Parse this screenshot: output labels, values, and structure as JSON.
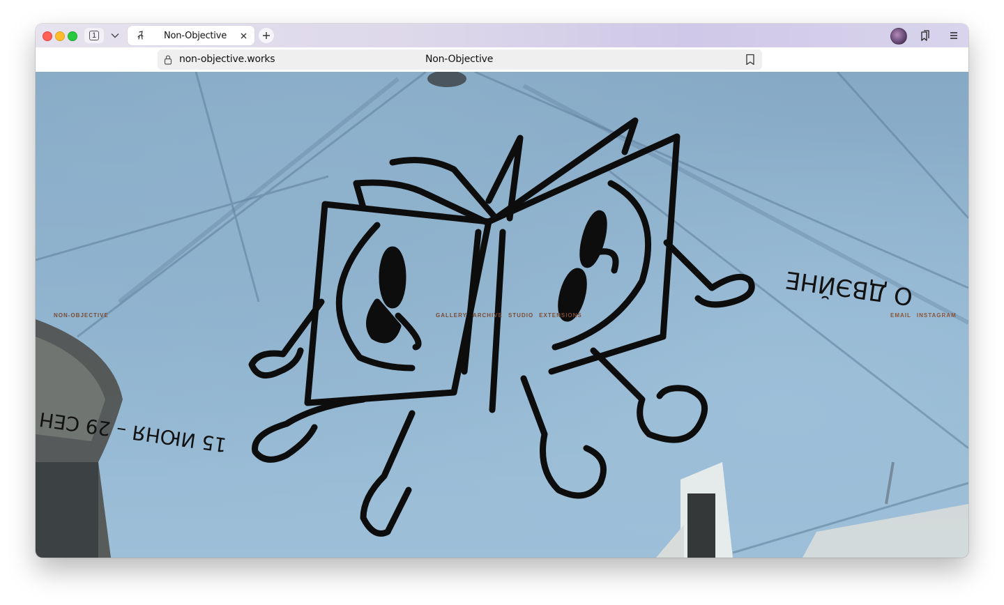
{
  "browser": {
    "tab_count": "1",
    "active_tab": {
      "title": "Non-Objective"
    },
    "address_bar": {
      "url": "non-objective.works",
      "page_title": "Non-Objective"
    }
  },
  "site": {
    "logo": "NON-OBJECTIVE",
    "nav": [
      "GALLERY",
      "ARCHIVE",
      "STUDIO",
      "EXTENSIONS"
    ],
    "links": [
      "EMAIL",
      "INSTAGRAM"
    ],
    "photo_text_right": "О ДВЭЙНЕ",
    "photo_text_left": "15 ИЮНЯ – 29 СЕН"
  },
  "colors": {
    "sky": "#92b5d1",
    "nav_text": "#7a4b33",
    "tabbar_accent": "#cfc8e8"
  },
  "icons": {
    "tab_favicon": "figure-icon",
    "tab_close": "close-icon",
    "new_tab": "plus-icon",
    "tab_list": "chevron-down-icon",
    "lock": "lock-icon",
    "bookmark": "bookmark-icon",
    "reading_list": "bookmarks-icon",
    "menu": "menu-icon"
  }
}
